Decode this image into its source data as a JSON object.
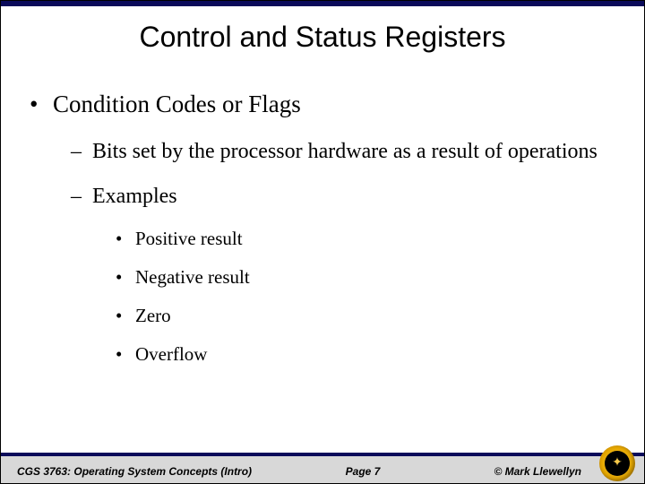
{
  "title": "Control and Status Registers",
  "bullets": {
    "l1": "Condition Codes or Flags",
    "l2a": "Bits set by the processor hardware as a result of operations",
    "l2b": "Examples",
    "l3a": "Positive result",
    "l3b": "Negative result",
    "l3c": "Zero",
    "l3d": "Overflow"
  },
  "footer": {
    "left": "CGS 3763: Operating System Concepts (Intro)",
    "center": "Page 7",
    "right": "© Mark Llewellyn"
  }
}
